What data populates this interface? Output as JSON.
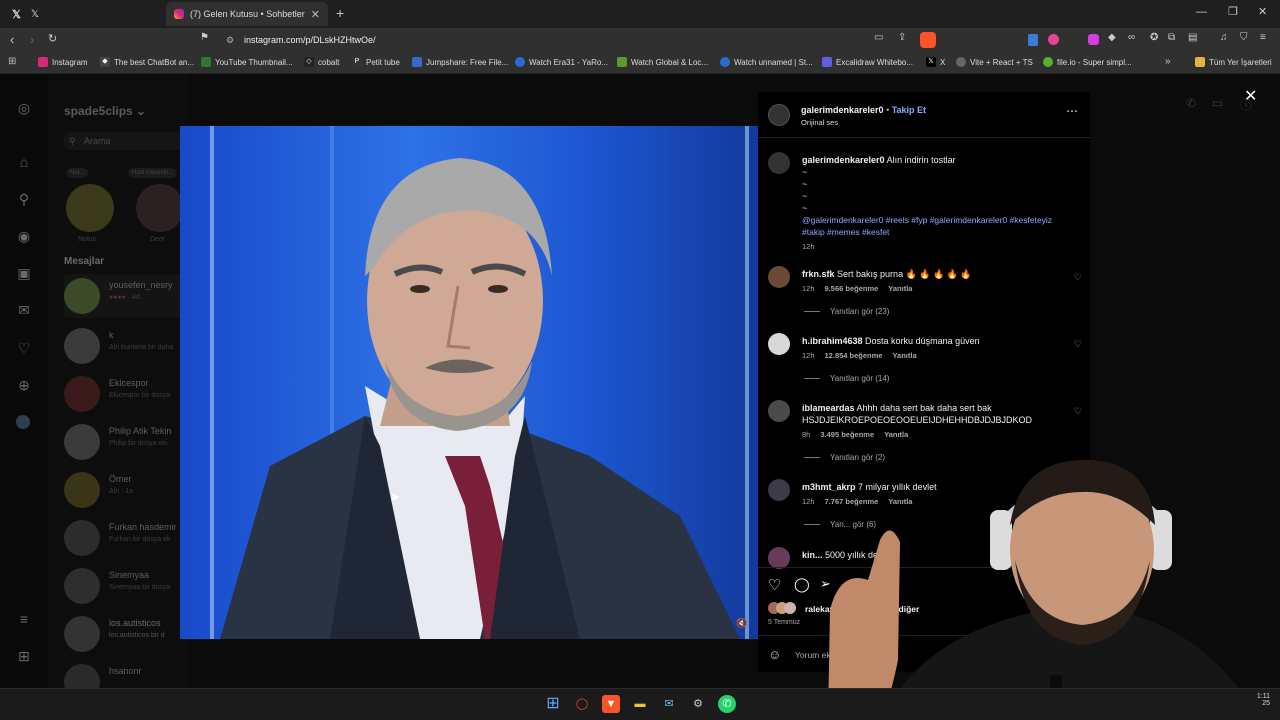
{
  "browser": {
    "tab_inactive_icon": "x-logo",
    "tab_active_title": "(7) Gelen Kutusu • Sohbetler",
    "url": "instagram.com/p/DLskHZHtwOe/",
    "bookmarks": [
      "Instagram",
      "The best ChatBot an...",
      "YouTube Thumbnail...",
      "cobalt",
      "Petit tube",
      "Jumpshare: Free File...",
      "Watch Era31 - YaRo...",
      "Watch Global & Loc...",
      "Watch unnamed | St...",
      "Excalidraw Whitebo...",
      "X",
      "Vite + React + TS",
      "file.io - Super simpl..."
    ],
    "bookmarks_folder": "Tüm Yer İşaretleri"
  },
  "dm": {
    "username": "spade5clips",
    "search_placeholder": "Arama",
    "notes": [
      "Notun",
      "Deni"
    ],
    "note_bubbles": [
      "Not...",
      "Hatti Gecenin..."
    ],
    "section_title": "Mesajlar",
    "messages": [
      {
        "name": "yousefen_nesry",
        "sub": "· 4d"
      },
      {
        "name": "k",
        "sub": "Abi bunlarla bir daha"
      },
      {
        "name": "Ekicespor",
        "sub": "Ekicespor bir dosya"
      },
      {
        "name": "Philip Atik Tekin",
        "sub": "Philip bir dosya eki"
      },
      {
        "name": "Ömer",
        "sub": "Abi · 1a"
      },
      {
        "name": "Furkan hasdemir",
        "sub": "Furkan bir dosya ek"
      },
      {
        "name": "Sinemyaa",
        "sub": "Sinemyaa bir dosya"
      },
      {
        "name": "los.autisticos",
        "sub": "los.autisticos bir d"
      },
      {
        "name": "hsanonr",
        "sub": ""
      }
    ]
  },
  "post": {
    "author": "galerimdenkareler0",
    "follow": "Takip Et",
    "audio": "Orijinal ses",
    "caption_author": "galerimdenkareler0",
    "caption_text": "Alın indirin tostlar",
    "caption_tilde": [
      "~",
      "~",
      "~",
      "~"
    ],
    "caption_tags": "@galerimdenkareler0 #reels #fyp #galerimdenkareler0 #kesfeteyiz #takip #memes #kesfet",
    "caption_time": "12h",
    "comments": [
      {
        "user": "frkn.sfk",
        "text": "Sert bakış purna 🔥 🔥 🔥 🔥 🔥",
        "time": "12h",
        "likes": "9.566 beğenme",
        "reply": "Yanıtla",
        "replies": "Yanıtları gör (23)"
      },
      {
        "user": "h.ibrahim4638",
        "text": "Dosta korku düşmana güven",
        "time": "12h",
        "likes": "12.854 beğenme",
        "reply": "Yanıtla",
        "replies": "Yanıtları gör (14)"
      },
      {
        "user": "iblameardas",
        "text": "Ahhh daha sert bak daha sert bak HSJDJEIKROEPOEOEOOEUEIJDHEHHDBJDJBJDKOD",
        "time": "8h",
        "likes": "3.495 beğenme",
        "reply": "Yanıtla",
        "replies": "Yanıtları gör (2)"
      },
      {
        "user": "m3hmt_akrp",
        "text": "7 milyar yıllık devlet",
        "time": "12h",
        "likes": "7.767 beğenme",
        "reply": "Yanıtla",
        "replies": "Yan... gör (6)"
      },
      {
        "user": "kin...",
        "text": "5000 yıllık devl...",
        "time": "",
        "likes": "",
        "reply": "",
        "replies": ""
      }
    ],
    "liked_by": "ralekaya",
    "liked_others": "4 diğer",
    "date": "5 Temmuz",
    "comment_placeholder": "Yorum ek..."
  },
  "clock": {
    "time": "1:11",
    "date": "25"
  },
  "colors": {
    "accent": "#0095f6",
    "link": "#e0f1ff",
    "tag": "#8aa9ff"
  }
}
